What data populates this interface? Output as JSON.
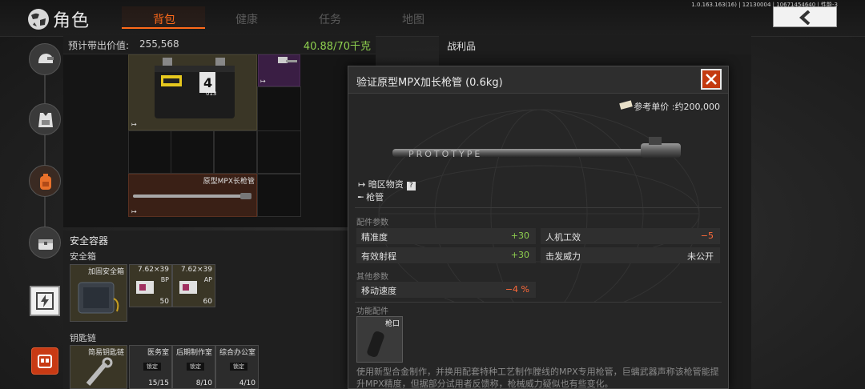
{
  "header": {
    "title": "角色",
    "tabs": [
      {
        "label": "背包",
        "active": true
      },
      {
        "label": "健康",
        "active": false
      },
      {
        "label": "任务",
        "active": false
      },
      {
        "label": "地图",
        "active": false
      }
    ],
    "version": "1.0.163.163(16) | 12130004 | 10671454640 | 性能-3",
    "back_icon": "chevron-left-icon"
  },
  "inventory": {
    "value_label": "预计带出价值:",
    "value_amount": "255,568",
    "weight": "40.88/70千克",
    "battery_label": "4",
    "battery_code": "013",
    "barrel_item_name": "原型MPX长枪管"
  },
  "secure": {
    "title": "安全容器",
    "box_label": "安全箱",
    "box_item": "加固安全箱",
    "ammo": [
      {
        "caliber": "7.62×39",
        "type": "BP",
        "count": "50"
      },
      {
        "caliber": "7.62×39",
        "type": "AP",
        "count": "60"
      }
    ],
    "keychain_label": "钥匙链",
    "keychain_item": "简易钥匙链",
    "keys": [
      {
        "name": "医务室",
        "status": "锁定",
        "count": "15/15"
      },
      {
        "name": "后期制作室",
        "status": "锁定",
        "count": "8/10"
      },
      {
        "name": "综合办公室",
        "status": "锁定",
        "count": "4/10"
      }
    ]
  },
  "loot": {
    "title": "战利品"
  },
  "popup": {
    "title": "验证原型MPX加长枪管 (0.6kg)",
    "price": "参考单价 :约200,000",
    "category": "暗区物资",
    "help": "?",
    "type": "枪管",
    "section_attachment": "配件参数",
    "stats": [
      {
        "label": "精准度",
        "value": "+30",
        "tone": "pos"
      },
      {
        "label": "人机工效",
        "value": "−5",
        "tone": "neg"
      },
      {
        "label": "有效射程",
        "value": "+30",
        "tone": "pos"
      },
      {
        "label": "击发威力",
        "value": "未公开",
        "tone": "neu"
      }
    ],
    "section_other": "其他参数",
    "other_stats": [
      {
        "label": "移动速度",
        "value": "−4 %",
        "tone": "neg"
      }
    ],
    "section_function": "功能配件",
    "function_slot": "枪口",
    "description": "使用新型合金制作，并换用配套特种工艺制作膛线的MPX专用枪管，巨螭武器声称该枪管能提升MPX精度，但据部分试用者反馈称，枪械威力疑似也有些变化。"
  },
  "colors": {
    "accent": "#ff6a1a",
    "positive": "#8fd14f",
    "negative": "#ff6a3a",
    "close": "#c43a10"
  }
}
